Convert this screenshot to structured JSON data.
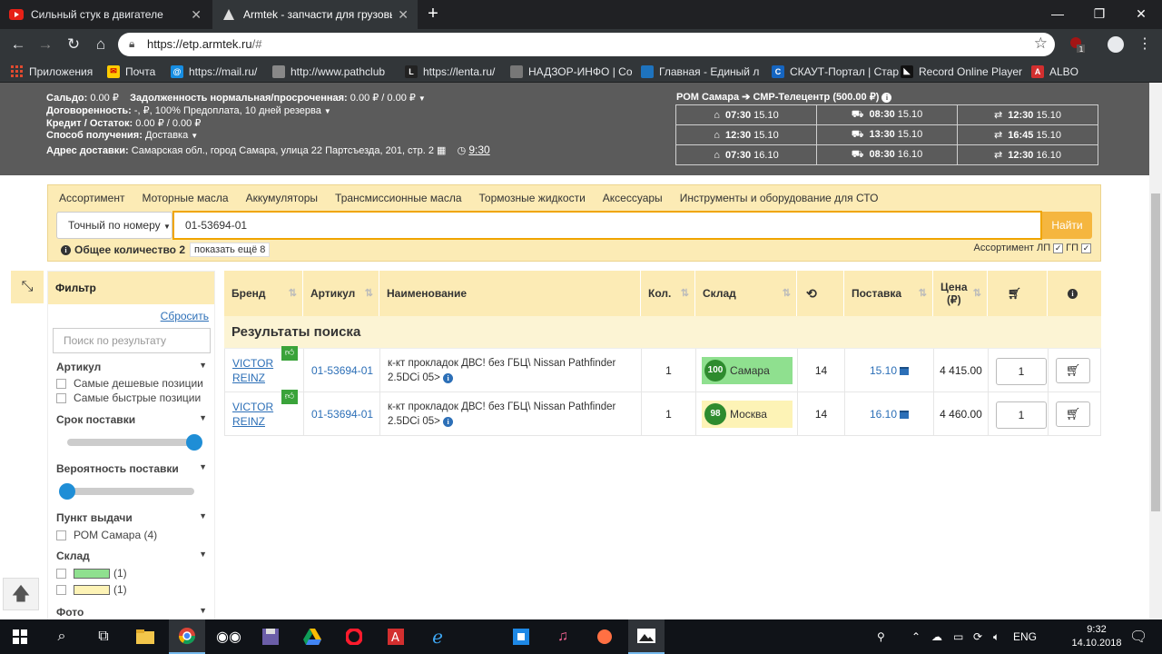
{
  "browser": {
    "tabs": [
      {
        "title": "Сильный стук в двигателе",
        "active": false
      },
      {
        "title": "Armtek - запчасти для грузовых",
        "active": true
      }
    ],
    "new_tab": "+",
    "window_controls": [
      "—",
      "❐",
      "✕"
    ],
    "url_host": "https://etp.armtek.ru",
    "url_rest": "/#",
    "bookmarks": [
      {
        "label": "Приложения",
        "color": "#e04a2f"
      },
      {
        "label": "Почта",
        "color": "#ffcc00"
      },
      {
        "label": "https://mail.ru/",
        "color": "#168de2"
      },
      {
        "label": "http://www.pathclub",
        "color": "#888888"
      },
      {
        "label": "https://lenta.ru/",
        "color": "#222222"
      },
      {
        "label": "НАДЗОР-ИНФО | Со",
        "color": "#777777"
      },
      {
        "label": "Главная - Единый л",
        "color": "#1e73be"
      },
      {
        "label": "СКАУТ-Портал | Стар",
        "color": "#1565c0"
      },
      {
        "label": "Record Online Player",
        "color": "#111111"
      },
      {
        "label": "ALBO",
        "color": "#d32f2f"
      }
    ]
  },
  "account": {
    "saldo_label": "Сальдо:",
    "saldo_value": "0.00 ₽",
    "debt_label": "Задолженность нормальная/просроченная:",
    "debt_value": "0.00 ₽ / 0.00 ₽",
    "contract_label": "Договоренность:",
    "contract_value": "-, ₽, 100% Предоплата, 10 дней резерва",
    "credit_label": "Кредит / Остаток:",
    "credit_value": "0.00 ₽ / 0.00 ₽",
    "method_label": "Способ получения:",
    "method_value": "Доставка",
    "address_label": "Адрес доставки:",
    "address_value": "Самарская обл., город Самара, улица 22 Партсъезда, 201, стр. 2",
    "time_value": "9:30"
  },
  "route": {
    "title": "РОМ Самара ➔ СМР-Телецентр (500.00 ₽)",
    "schedule": [
      [
        {
          "time": "07:30",
          "date": "15.10"
        },
        {
          "time": "08:30",
          "date": "15.10"
        },
        {
          "time": "12:30",
          "date": "15.10"
        }
      ],
      [
        {
          "time": "12:30",
          "date": "15.10"
        },
        {
          "time": "13:30",
          "date": "15.10"
        },
        {
          "time": "16:45",
          "date": "15.10"
        }
      ],
      [
        {
          "time": "07:30",
          "date": "16.10"
        },
        {
          "time": "08:30",
          "date": "16.10"
        },
        {
          "time": "12:30",
          "date": "16.10"
        }
      ]
    ]
  },
  "search": {
    "categories": [
      "Ассортимент",
      "Моторные масла",
      "Аккумуляторы",
      "Трансмиссионные масла",
      "Тормозные жидкости",
      "Аксессуары",
      "Инструменты и оборудование для СТО"
    ],
    "mode": "Точный по номеру",
    "query": "01-53694-01",
    "find_button": "Найти",
    "total_label": "Общее количество 2",
    "show_more": "показать ещё 8",
    "assortment_lp": "Ассортимент ЛП",
    "gp": "ГП"
  },
  "filter": {
    "title": "Фильтр",
    "reset": "Сбросить",
    "search_placeholder": "Поиск по результату",
    "article_title": "Артикул",
    "cheapest": "Самые дешевые позиции",
    "fastest": "Самые быстрые позиции",
    "delivery_term_title": "Срок поставки",
    "delivery_term_level": 1.0,
    "probability_title": "Вероятность поставки",
    "probability_level": 0.0,
    "pickup_title": "Пункт выдачи",
    "pickup_option": "РОМ Самара (4)",
    "warehouse_title": "Склад",
    "warehouse_options": [
      {
        "color": "#8fe08f",
        "count": "(1)"
      },
      {
        "color": "#fdf3b6",
        "count": "(1)"
      }
    ],
    "photo_title": "Фото"
  },
  "results": {
    "headers": {
      "brand": "Бренд",
      "article": "Артикул",
      "name": "Наименование",
      "qty": "Кол.",
      "warehouse": "Склад",
      "delivery": "Поставка",
      "price_line1": "Цена",
      "price_line2": "(₽)"
    },
    "section_title": "Результаты поиска",
    "rows": [
      {
        "brand_line1": "VICTOR",
        "brand_line2": "REINZ",
        "article": "01-53694-01",
        "name_line1": "к-кт прокладок ДВС! без ГБЦ\\ Nissan Pathfinder",
        "name_line2": "2.5DCi 05>",
        "qty": "1",
        "stock_num": "100",
        "stock_name": "Самара",
        "stock_color": "#8fe08f",
        "days": "14",
        "delivery": "15.10",
        "price": "4 415.00",
        "order_qty": "1"
      },
      {
        "brand_line1": "VICTOR",
        "brand_line2": "REINZ",
        "article": "01-53694-01",
        "name_line1": "к-кт прокладок ДВС! без ГБЦ\\ Nissan Pathfinder",
        "name_line2": "2.5DCi 05>",
        "qty": "1",
        "stock_num": "98",
        "stock_name": "Москва",
        "stock_color": "#fdf3b6",
        "days": "14",
        "delivery": "16.10",
        "price": "4 460.00",
        "order_qty": "1"
      }
    ]
  },
  "taskbar": {
    "lang": "ENG",
    "time": "9:32",
    "date": "14.10.2018"
  }
}
